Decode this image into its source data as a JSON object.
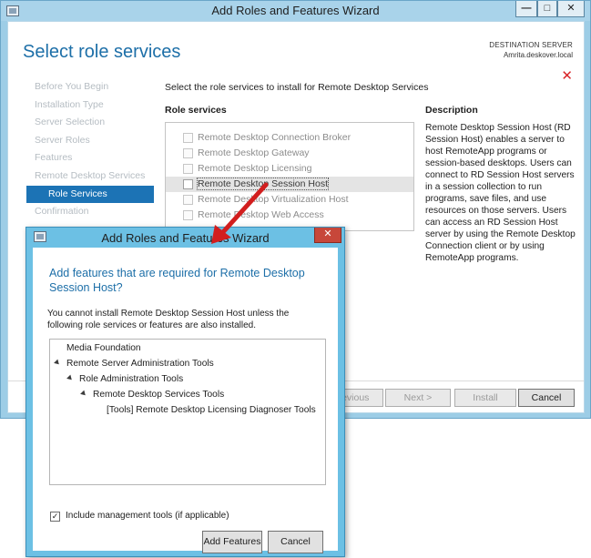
{
  "main_window": {
    "title": "Add Roles and Features Wizard",
    "controls": {
      "minimize": "—",
      "maximize": "□",
      "close": "✕"
    },
    "page_title": "Select role services",
    "destination_label": "DESTINATION SERVER",
    "destination_server": "Amrita.deskover.local",
    "nav": [
      "Before You Begin",
      "Installation Type",
      "Server Selection",
      "Server Roles",
      "Features",
      "Remote Desktop Services",
      "Role Services",
      "Confirmation"
    ],
    "instruction": "Select the role services to install for Remote Desktop Services",
    "role_services_header": "Role services",
    "role_services": [
      "Remote Desktop Connection Broker",
      "Remote Desktop Gateway",
      "Remote Desktop Licensing",
      "Remote Desktop Session Host",
      "Remote Desktop Virtualization Host",
      "Remote Desktop Web Access"
    ],
    "description_header": "Description",
    "description_text": "Remote Desktop Session Host (RD Session Host) enables a server to host RemoteApp programs or session-based desktops. Users can connect to RD Session Host servers in a session collection to run programs, save files, and use resources on those servers. Users can access an RD Session Host server by using the Remote Desktop Connection client or by using RemoteApp programs.",
    "buttons": {
      "previous": "Previous",
      "next": "Next >",
      "install": "Install",
      "cancel": "Cancel"
    }
  },
  "dialog": {
    "title": "Add Roles and Features Wizard",
    "close": "✕",
    "heading": "Add features that are required for Remote Desktop Session Host?",
    "message": "You cannot install Remote Desktop Session Host unless the following role services or features are also installed.",
    "tree": [
      "Media Foundation",
      "Remote Server Administration Tools",
      "Role Administration Tools",
      "Remote Desktop Services Tools",
      "[Tools] Remote Desktop Licensing Diagnoser Tools"
    ],
    "include_mgmt_label": "Include management tools (if applicable)",
    "include_mgmt_checked": true,
    "checkmark": "✓",
    "buttons": {
      "add_features": "Add Features",
      "cancel": "Cancel"
    }
  },
  "colors": {
    "accent_blue": "#1d6fa8",
    "nav_active": "#1c73b5",
    "annotation_arrow": "#d21e1e",
    "close_red": "#c7473a"
  }
}
